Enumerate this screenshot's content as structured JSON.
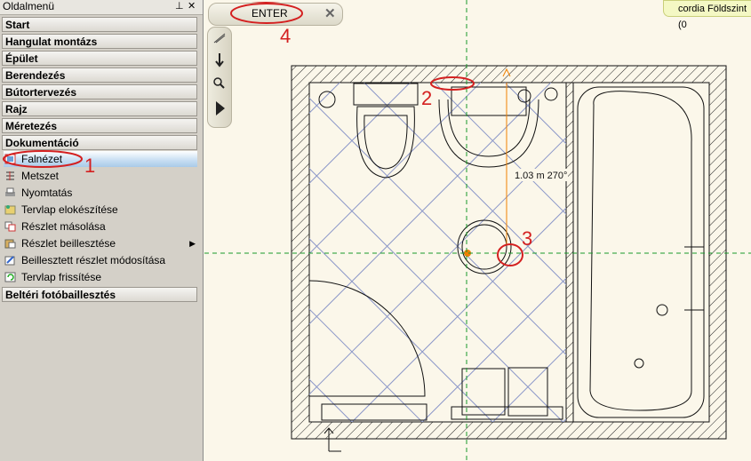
{
  "panel": {
    "title": "Oldalmenü",
    "pin_icon": "pin-icon",
    "close_icon": "close-icon",
    "groups_top": [
      "Start",
      "Hangulat montázs",
      "Épület",
      "Berendezés",
      "Bútortervezés",
      "Rajz",
      "Méretezés",
      "Dokumentáció"
    ],
    "items": [
      {
        "label": "Falnézet",
        "icon": "wall-view-icon",
        "selected": true
      },
      {
        "label": "Metszet",
        "icon": "section-icon"
      },
      {
        "label": "Nyomtatás",
        "icon": "printer-icon"
      },
      {
        "label": "Tervlap elokészítése",
        "icon": "layout-prepare-icon"
      },
      {
        "label": "Részlet másolása",
        "icon": "copy-detail-icon"
      },
      {
        "label": "Részlet beillesztése",
        "icon": "paste-detail-icon",
        "submenu": true
      },
      {
        "label": "Beillesztett részlet módosítása",
        "icon": "modify-detail-icon"
      },
      {
        "label": "Tervlap frissítése",
        "icon": "refresh-icon"
      }
    ],
    "groups_bottom": [
      "Beltéri fotóbaillesztés"
    ]
  },
  "toolbar": {
    "enter_label": "ENTER",
    "close_icon": "close-icon"
  },
  "level_badge": "cordia Földszint (0",
  "dimension_label": "1.03 m  270°",
  "annotations": [
    "1",
    "2",
    "3",
    "4"
  ],
  "colors": {
    "annotation": "#d42020",
    "guide": "#1a9a2a",
    "hatch": "#8a96c8",
    "accent": "#f08000"
  }
}
